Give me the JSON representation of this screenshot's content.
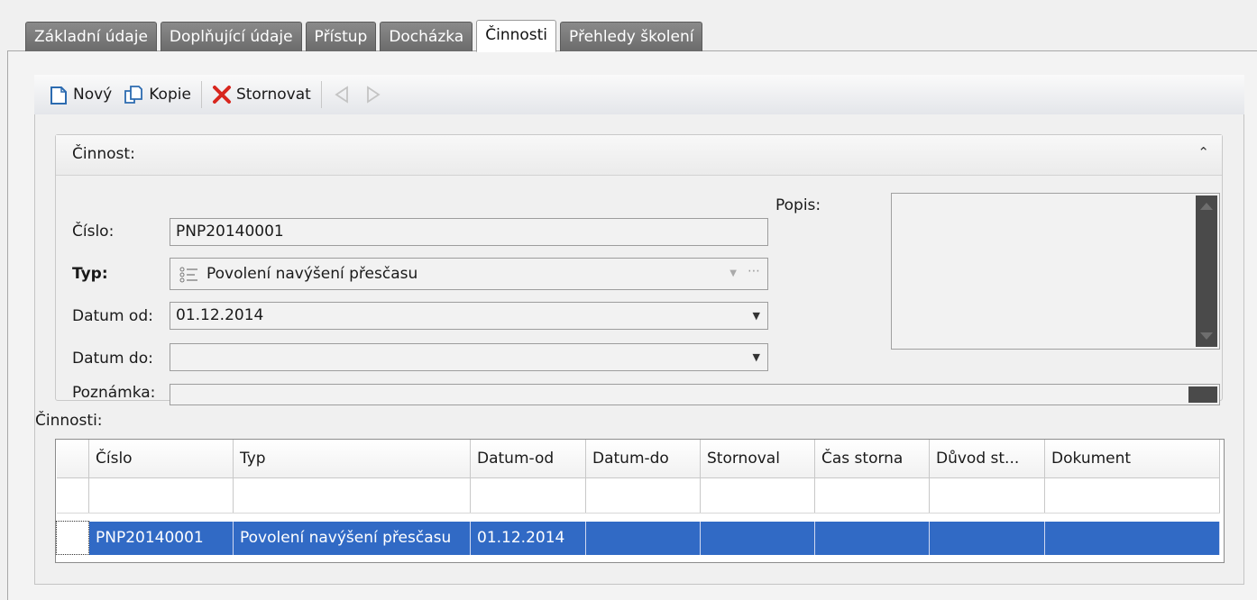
{
  "tabs": [
    "Základní údaje",
    "Doplňující údaje",
    "Přístup",
    "Docházka",
    "Činnosti",
    "Přehledy školení"
  ],
  "active_tab": "Činnosti",
  "toolbar": {
    "new_label": "Nový",
    "copy_label": "Kopie",
    "cancel_label": "Stornovat"
  },
  "group": {
    "title": "Činnost:",
    "labels": {
      "cislo": "Číslo:",
      "typ": "Typ:",
      "datum_od": "Datum od:",
      "datum_do": "Datum do:",
      "poznamka": "Poznámka:",
      "popis": "Popis:"
    },
    "values": {
      "cislo": "PNP20140001",
      "typ": "Povolení navýšení přesčasu",
      "datum_od": "01.12.2014",
      "datum_do": "",
      "poznamka": "",
      "popis": ""
    }
  },
  "list": {
    "title": "Činnosti:",
    "columns": [
      "Číslo",
      "Typ",
      "Datum-od",
      "Datum-do",
      "Stornoval",
      "Čas storna",
      "Důvod st...",
      "Dokument"
    ],
    "rows": [
      [
        "PNP20140001",
        "Povolení navýšení přesčasu",
        "01.12.2014",
        "",
        "",
        "",
        "",
        ""
      ]
    ]
  },
  "colors": {
    "selection": "#316ac5",
    "tab_inactive": "#7a7a7a",
    "cancel_icon": "#d8261e"
  }
}
